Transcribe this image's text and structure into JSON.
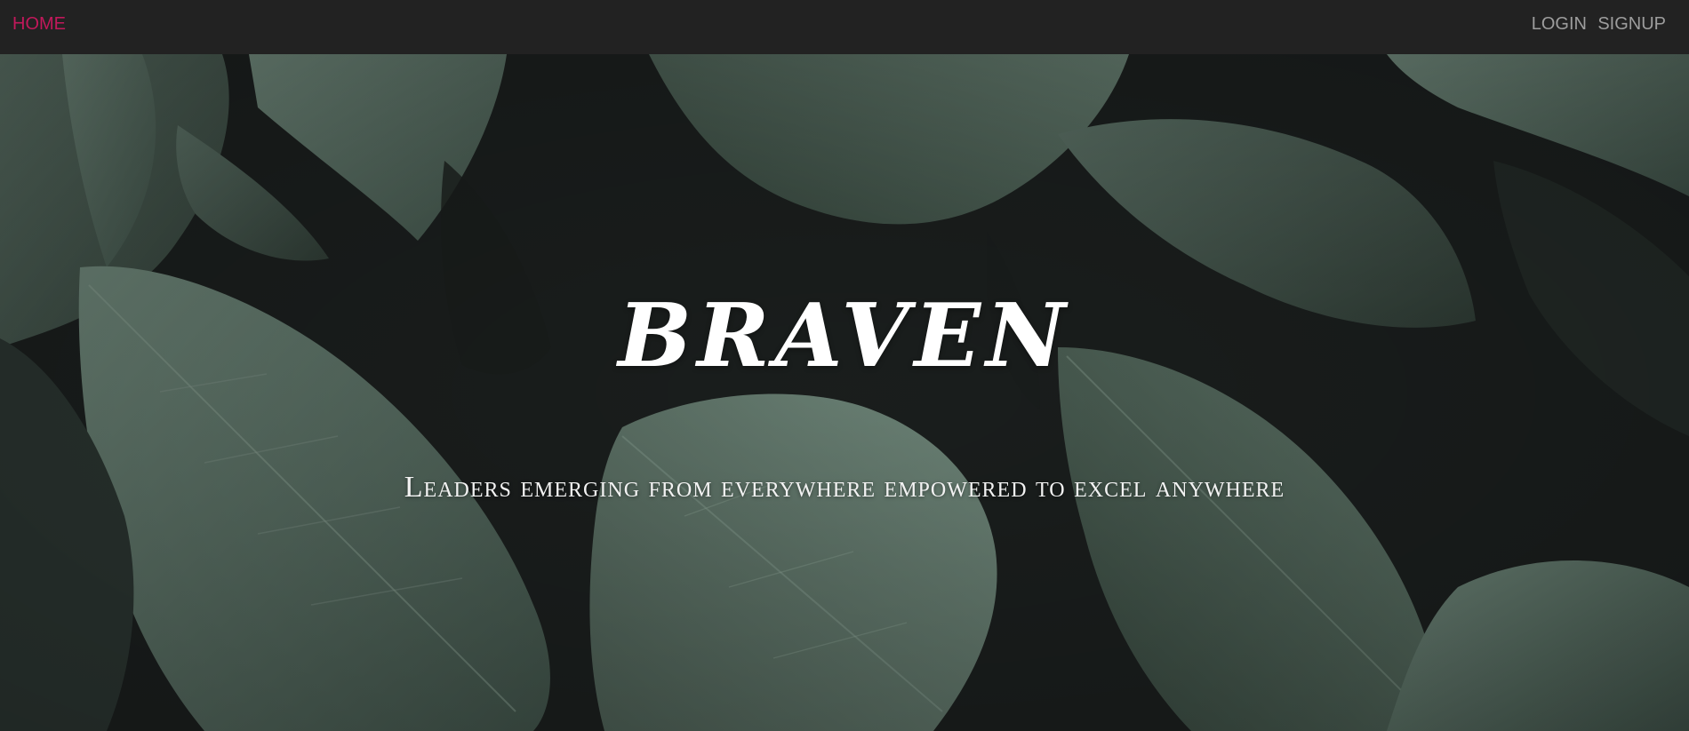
{
  "nav": {
    "home_label": "HOME",
    "login_label": "LOGIN",
    "signup_label": "SIGNUP",
    "active_color": "#c2185b",
    "link_color": "#9d9d9d",
    "background": "#222222"
  },
  "hero": {
    "title": "BRAVEN",
    "subtitle": "Leaders emerging from everywhere empowered to excel anywhere",
    "background_image": "dark-green-leaves-background"
  }
}
